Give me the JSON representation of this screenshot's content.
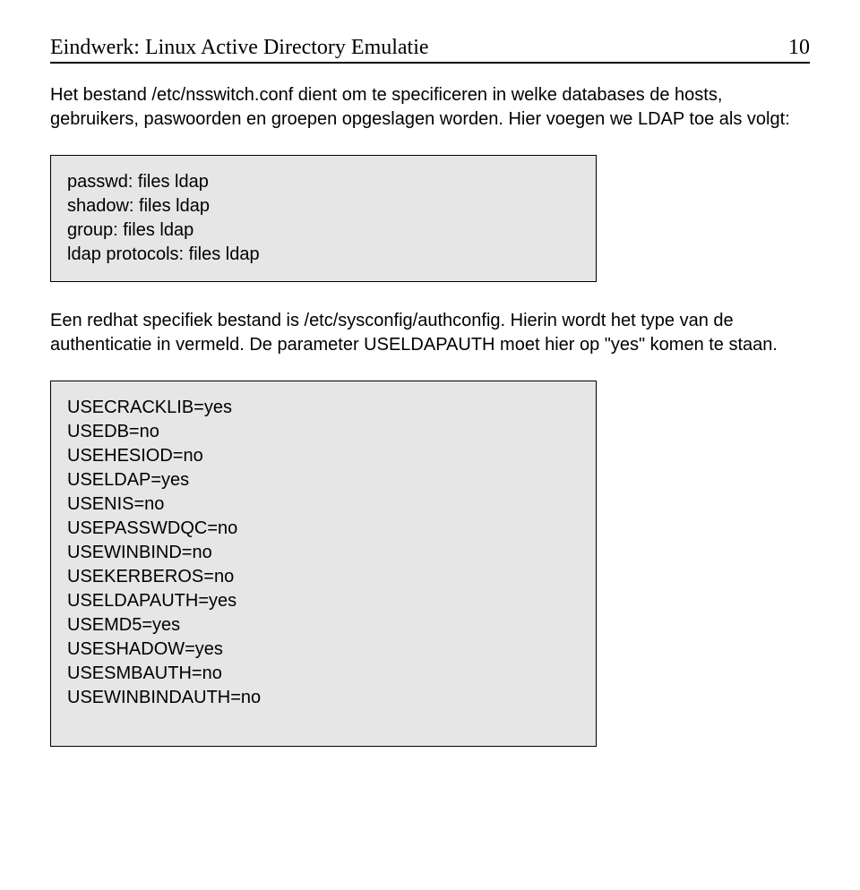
{
  "header": {
    "title": "Eindwerk: Linux Active Directory Emulatie",
    "page_number": "10"
  },
  "paragraphs": {
    "p1": "Het bestand /etc/nsswitch.conf dient om te specificeren in welke databases de hosts, gebruikers, paswoorden en groepen opgeslagen worden. Hier voegen we LDAP toe als volgt:",
    "p2": "Een redhat specifiek bestand is /etc/sysconfig/authconfig. Hierin wordt het type van de authenticatie in vermeld. De parameter USELDAPAUTH moet hier op \"yes\" komen te staan."
  },
  "codebox1": {
    "l1": "passwd: files ldap",
    "l2": "shadow: files ldap",
    "l3": "group: files ldap",
    "l4": "ldap protocols: files ldap"
  },
  "codebox2": {
    "l1": "USECRACKLIB=yes",
    "l2": "USEDB=no",
    "l3": "USEHESIOD=no",
    "l4": "USELDAP=yes",
    "l5": "USENIS=no",
    "l6": "USEPASSWDQC=no",
    "l7": "USEWINBIND=no",
    "l8": "USEKERBEROS=no",
    "l9": "USELDAPAUTH=yes",
    "l10": "USEMD5=yes",
    "l11": "USESHADOW=yes",
    "l12": "USESMBAUTH=no",
    "l13": "USEWINBINDAUTH=no"
  }
}
